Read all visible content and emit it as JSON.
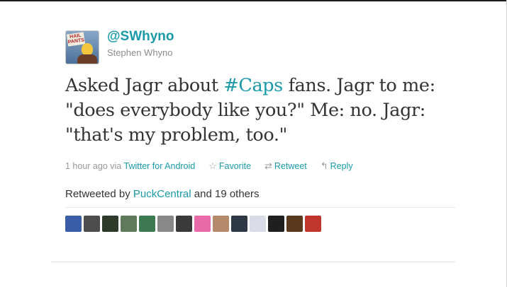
{
  "user": {
    "handle": "@SWhyno",
    "name": "Stephen Whyno",
    "avatar_sign_text": "HAIL PANTS"
  },
  "tweet": {
    "text_before": "Asked Jagr about ",
    "hashtag": "#Caps",
    "text_after": " fans. Jagr to me: \"does everybody like you?\" Me: no. Jagr: \"that's my problem, too.\""
  },
  "meta": {
    "time": "1 hour ago",
    "via_label": "via",
    "client": "Twitter for Android",
    "favorite_label": "Favorite",
    "retweet_label": "Retweet",
    "reply_label": "Reply",
    "favorite_icon": "☆",
    "retweet_icon": "⇄",
    "reply_icon": "↰"
  },
  "retweets": {
    "prefix": "Retweeted by",
    "first_user": "PuckCentral",
    "suffix": "and 19 others"
  },
  "retweeter_avatars": [
    {
      "name": "retweeter-avatar-1",
      "color": "#3a5fa8"
    },
    {
      "name": "retweeter-avatar-2",
      "color": "#4d4d4d"
    },
    {
      "name": "retweeter-avatar-3",
      "color": "#2e3b2a"
    },
    {
      "name": "retweeter-avatar-4",
      "color": "#5e7a5a"
    },
    {
      "name": "retweeter-avatar-5",
      "color": "#3d7a52"
    },
    {
      "name": "retweeter-avatar-6",
      "color": "#888888"
    },
    {
      "name": "retweeter-avatar-7",
      "color": "#3a3a3a"
    },
    {
      "name": "retweeter-avatar-8",
      "color": "#e86aa8"
    },
    {
      "name": "retweeter-avatar-9",
      "color": "#b48a6a"
    },
    {
      "name": "retweeter-avatar-10",
      "color": "#2d3a46"
    },
    {
      "name": "retweeter-avatar-11",
      "color": "#d9dbe6"
    },
    {
      "name": "retweeter-avatar-12",
      "color": "#1f1f1f"
    },
    {
      "name": "retweeter-avatar-13",
      "color": "#5a3a1e"
    },
    {
      "name": "retweeter-avatar-14",
      "color": "#c0362c"
    }
  ],
  "colors": {
    "link": "#1a9aa8",
    "text": "#333333",
    "muted": "#999999"
  }
}
